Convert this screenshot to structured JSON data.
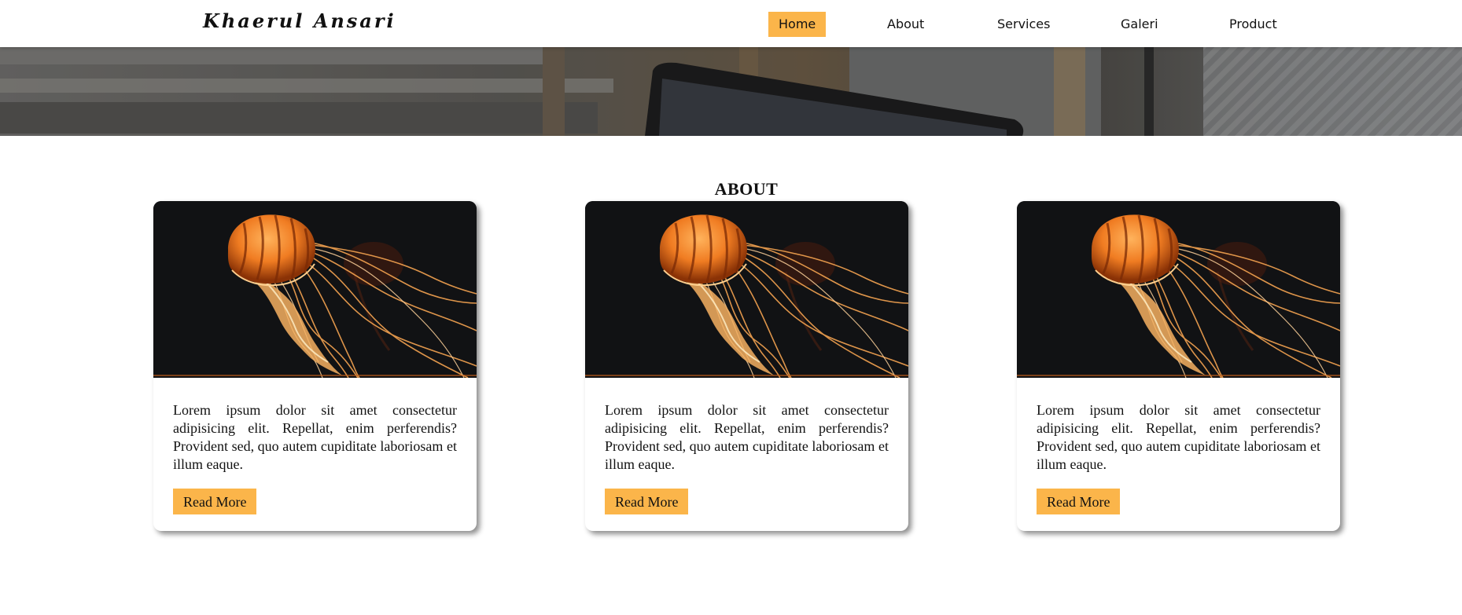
{
  "header": {
    "brand": "Khaerul Ansari",
    "nav": [
      {
        "label": "Home",
        "active": true
      },
      {
        "label": "About",
        "active": false
      },
      {
        "label": "Services",
        "active": false
      },
      {
        "label": "Galeri",
        "active": false
      },
      {
        "label": "Product",
        "active": false
      }
    ]
  },
  "about": {
    "title": "ABOUT",
    "cards": [
      {
        "text": "Lorem ipsum dolor sit amet consectetur adipisicing elit. Repellat, enim perferendis? Provident sed, quo autem cupiditate laboriosam et illum eaque.",
        "button": "Read More"
      },
      {
        "text": "Lorem ipsum dolor sit amet consectetur adipisicing elit. Repellat, enim perferendis? Provident sed, quo autem cupiditate laboriosam et illum eaque.",
        "button": "Read More"
      },
      {
        "text": "Lorem ipsum dolor sit amet consectetur adipisicing elit. Repellat, enim perferendis? Provident sed, quo autem cupiditate laboriosam et illum eaque.",
        "button": "Read More"
      }
    ]
  },
  "colors": {
    "accent": "#fbb54a",
    "card_image_bg": "#111214",
    "text": "#111111"
  }
}
